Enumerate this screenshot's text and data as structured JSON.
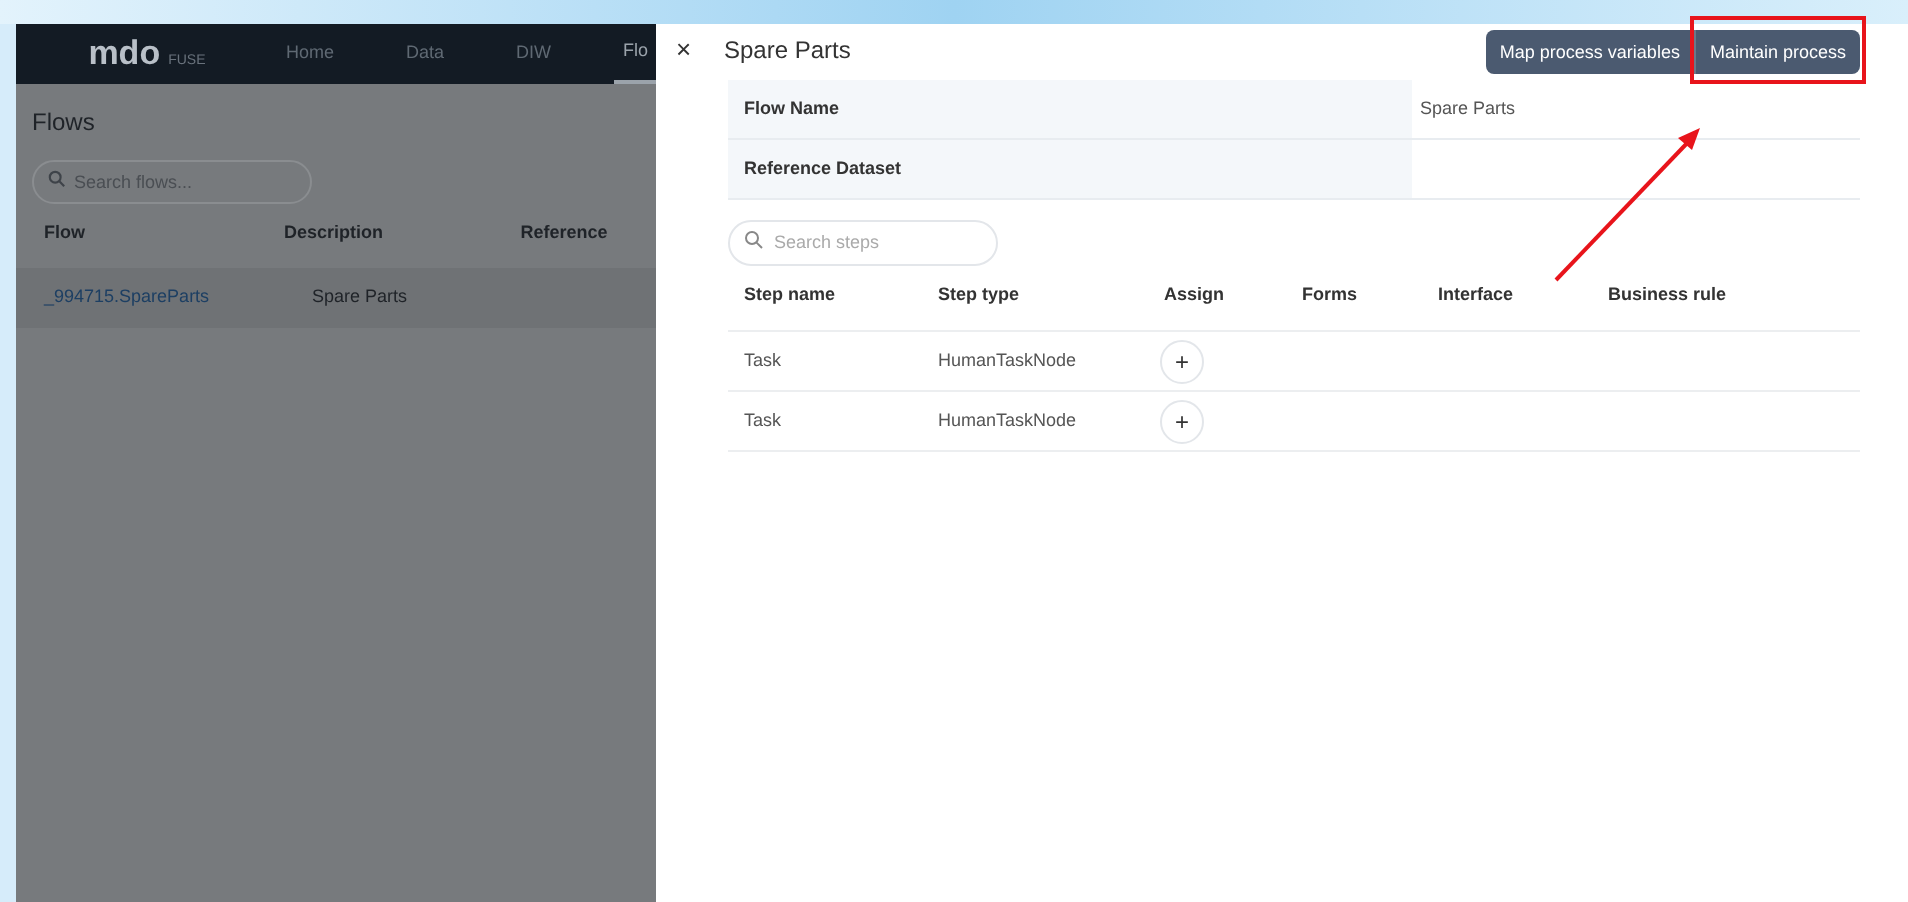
{
  "app": {
    "logo": "mdo",
    "logo_suffix": "FUSE",
    "nav": [
      {
        "label": "Home",
        "selected": false
      },
      {
        "label": "Data",
        "selected": false
      },
      {
        "label": "DIW",
        "selected": false
      },
      {
        "label": "Flo",
        "selected": true
      }
    ]
  },
  "flows": {
    "title": "Flows",
    "search": {
      "placeholder": "Search flows..."
    },
    "columns": [
      "Flow",
      "Description",
      "Reference"
    ],
    "rows": [
      {
        "flow": "_994715.SpareParts",
        "description": "Spare Parts"
      }
    ]
  },
  "panel": {
    "close": "×",
    "title": "Spare Parts",
    "buttons": [
      {
        "label": "Map process variables",
        "highlighted": false
      },
      {
        "label": "Maintain process",
        "highlighted": true
      }
    ],
    "details": [
      {
        "label": "Flow Name",
        "value": "Spare Parts"
      },
      {
        "label": "Reference Dataset"
      }
    ],
    "search": {
      "placeholder": "Search steps"
    },
    "columns": [
      "Step name",
      "Step type",
      "Assign",
      "Forms",
      "Interface",
      "Business rule"
    ],
    "steps": [
      {
        "name": "Task",
        "type": "HumanTaskNode",
        "assign": "+"
      },
      {
        "name": "Task",
        "type": "HumanTaskNode",
        "assign": "+"
      }
    ]
  }
}
